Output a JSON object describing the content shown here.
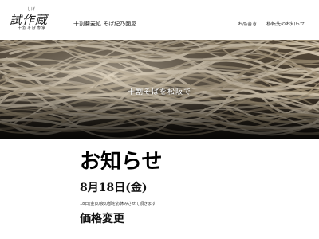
{
  "header": {
    "logo": {
      "ruby": "しば",
      "main": "試作蔵",
      "sub": "十割そば専家"
    },
    "shop_name": "十割蕎麦処 そば紀乃國屋",
    "nav": [
      {
        "label": "お品書き"
      },
      {
        "label": "移転先のお知らせ"
      }
    ]
  },
  "hero": {
    "caption": "十割そばを松阪で"
  },
  "main": {
    "title": "お知らせ",
    "date": "8月18日(金)",
    "body": "18日(金)の夜の部をお休みさせて頂きます",
    "subheading": "価格変更"
  },
  "colors": {
    "hero_bg": "#3b3328",
    "noodle_light": "#d8cbb4",
    "noodle_mid": "#a8987c",
    "text": "#111111"
  }
}
